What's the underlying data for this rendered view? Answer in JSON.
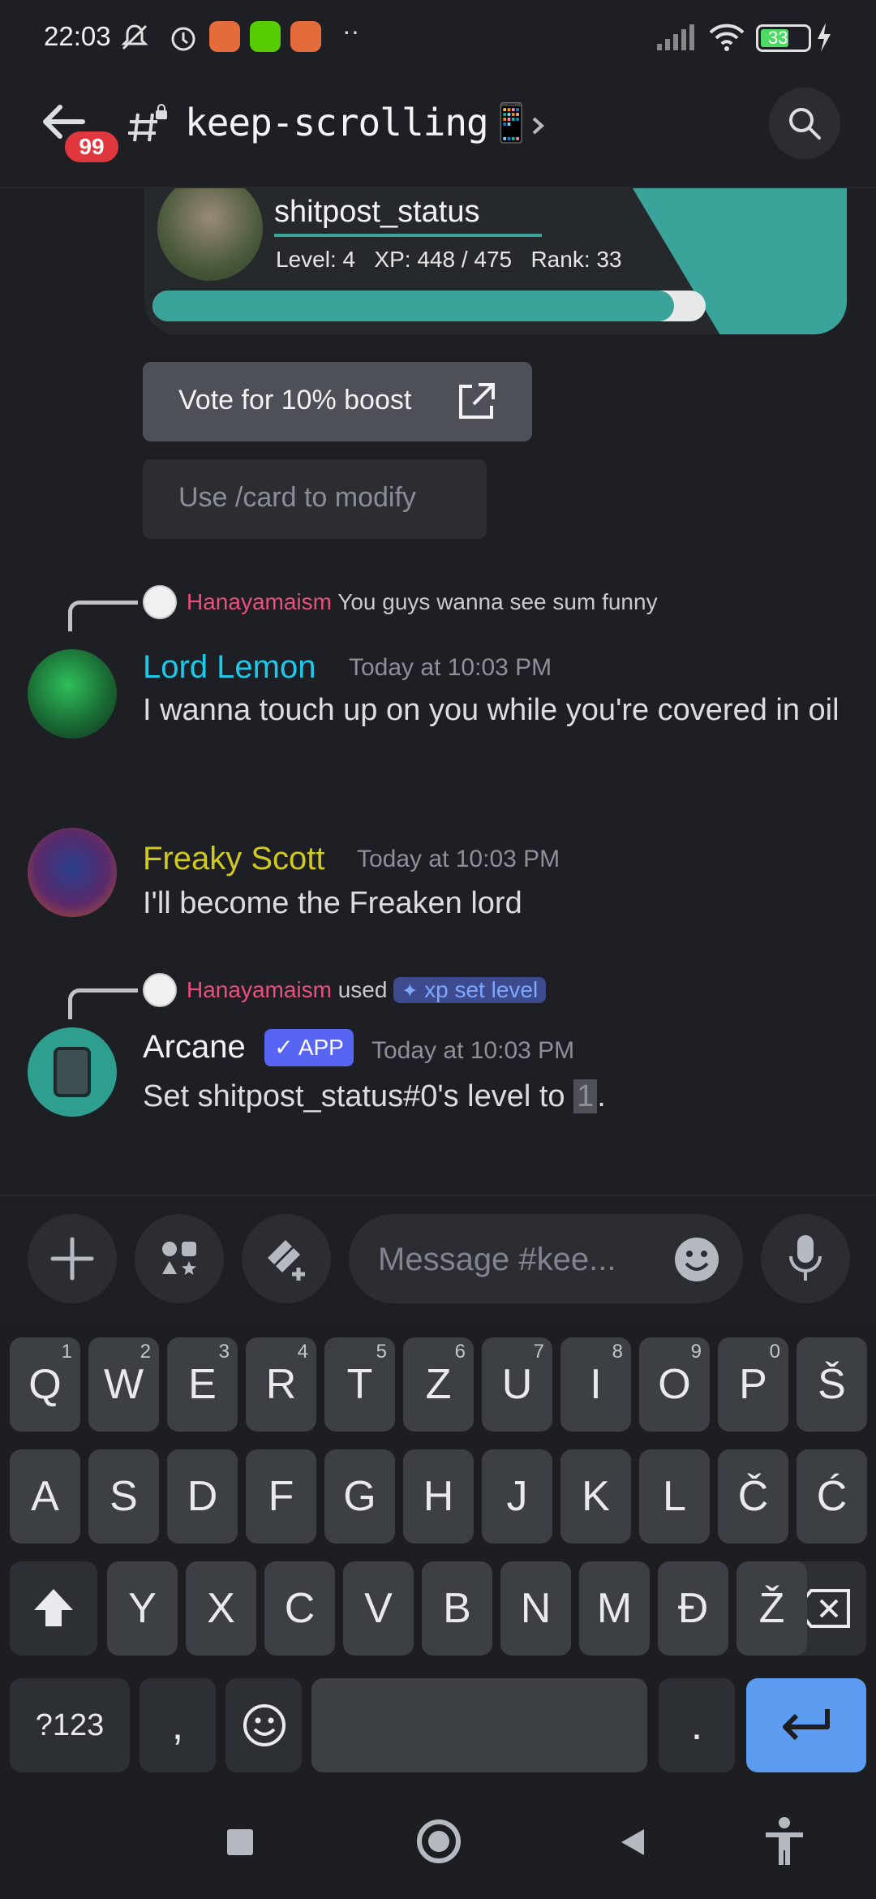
{
  "status_bar": {
    "time": "22:03",
    "battery": "33"
  },
  "header": {
    "back_badge": "99",
    "channel": "keep-scrolling📱"
  },
  "rank_card": {
    "username": "shitpost_status",
    "level_text": "Level: 4",
    "xp_text": "XP: 448 / 475",
    "rank_text": "Rank: 33",
    "progress": 0.943
  },
  "buttons": {
    "vote": "Vote for 10% boost",
    "card": "Use /card to modify"
  },
  "messages": [
    {
      "reply_author": "Hanayamaism",
      "reply_text": "You guys wanna see sum funny",
      "author": "Lord Lemon",
      "author_color": "#1ec8e8",
      "time": "Today at 10:03 PM",
      "text": "I wanna touch up on you while you're covered in oil"
    },
    {
      "author": "Freaky Scott",
      "author_color": "#d2c91f",
      "time": "Today at 10:03 PM",
      "text": "I'll become the Freaken lord"
    },
    {
      "reply_author": "Hanayamaism",
      "reply_used": "used",
      "reply_command": "xp set level",
      "author": "Arcane",
      "author_color": "#f2f3f5",
      "app_tag": "APP",
      "time": "Today at 10:03 PM",
      "text_prefix": "Set shitpost_status#0's level to ",
      "text_value": "1",
      "text_suffix": "."
    }
  ],
  "composer": {
    "placeholder": "Message #kee..."
  },
  "keyboard": {
    "row1": [
      {
        "k": "Q",
        "h": "1"
      },
      {
        "k": "W",
        "h": "2"
      },
      {
        "k": "E",
        "h": "3"
      },
      {
        "k": "R",
        "h": "4"
      },
      {
        "k": "T",
        "h": "5"
      },
      {
        "k": "Z",
        "h": "6"
      },
      {
        "k": "U",
        "h": "7"
      },
      {
        "k": "I",
        "h": "8"
      },
      {
        "k": "O",
        "h": "9"
      },
      {
        "k": "P",
        "h": "0"
      },
      {
        "k": "Š",
        "h": ""
      }
    ],
    "row2": [
      "A",
      "S",
      "D",
      "F",
      "G",
      "H",
      "J",
      "K",
      "L",
      "Č",
      "Ć"
    ],
    "row3": [
      "Y",
      "X",
      "C",
      "V",
      "B",
      "N",
      "M",
      "Đ",
      "Ž"
    ],
    "sym": "?123",
    "comma": ",",
    "period": "."
  },
  "colors": {
    "accent_teal": "#3aa39a",
    "mention_pink": "#ec4f7b",
    "app_blurple": "#5865f2",
    "enter_blue": "#5b9cf0"
  }
}
